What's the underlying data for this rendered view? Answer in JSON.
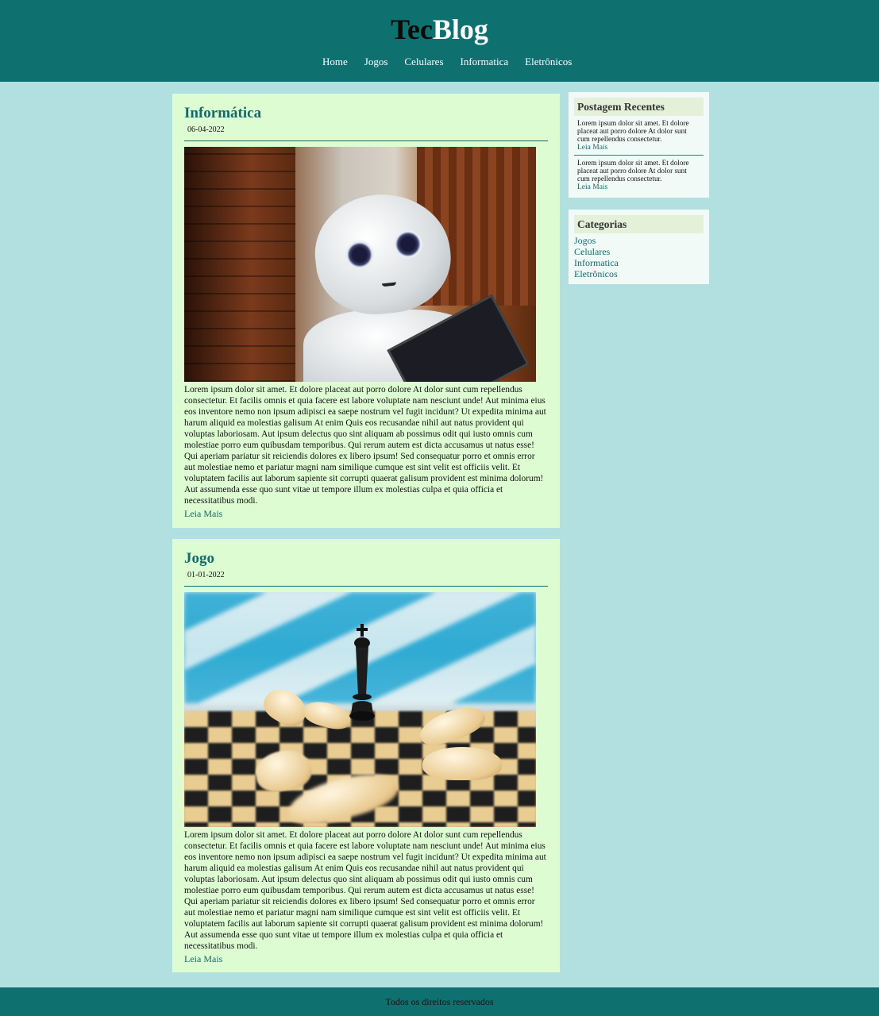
{
  "header": {
    "logo_part1": "Tec",
    "logo_part2": "Blog",
    "nav": [
      "Home",
      "Jogos",
      "Celulares",
      "Informatica",
      "Eletrônicos"
    ]
  },
  "posts": [
    {
      "title": "Informática",
      "date": "06-04-2022",
      "image": "robot-image",
      "body": "Lorem ipsum dolor sit amet. Et dolore placeat aut porro dolore At dolor sunt cum repellendus consectetur. Et facilis omnis et quia facere est labore voluptate nam nesciunt unde! Aut minima eius eos inventore nemo non ipsum adipisci ea saepe nostrum vel fugit incidunt? Ut expedita minima aut harum aliquid ea molestias galisum At enim Quis eos recusandae nihil aut natus provident qui voluptas laboriosam. Aut ipsum delectus quo sint aliquam ab possimus odit qui iusto omnis cum molestiae porro eum quibusdam temporibus. Qui rerum autem est dicta accusamus ut natus esse! Qui aperiam pariatur sit reiciendis dolores ex libero ipsum! Sed consequatur porro et omnis error aut molestiae nemo et pariatur magni nam similique cumque est sint velit est officiis velit. Et voluptatem facilis aut laborum sapiente sit corrupti quaerat galisum provident est minima dolorum! Aut assumenda esse quo sunt vitae ut tempore illum ex molestias culpa et quia officia et necessitatibus modi.",
      "read_more": "Leia Mais"
    },
    {
      "title": "Jogo",
      "date": "01-01-2022",
      "image": "chess-image",
      "body": "Lorem ipsum dolor sit amet. Et dolore placeat aut porro dolore At dolor sunt cum repellendus consectetur. Et facilis omnis et quia facere est labore voluptate nam nesciunt unde! Aut minima eius eos inventore nemo non ipsum adipisci ea saepe nostrum vel fugit incidunt? Ut expedita minima aut harum aliquid ea molestias galisum At enim Quis eos recusandae nihil aut natus provident qui voluptas laboriosam. Aut ipsum delectus quo sint aliquam ab possimus odit qui iusto omnis cum molestiae porro eum quibusdam temporibus. Qui rerum autem est dicta accusamus ut natus esse! Qui aperiam pariatur sit reiciendis dolores ex libero ipsum! Sed consequatur porro et omnis error aut molestiae nemo et pariatur magni nam similique cumque est sint velit est officiis velit. Et voluptatem facilis aut laborum sapiente sit corrupti quaerat galisum provident est minima dolorum! Aut assumenda esse quo sunt vitae ut tempore illum ex molestias culpa et quia officia et necessitatibus modi.",
      "read_more": "Leia Mais"
    }
  ],
  "sidebar": {
    "recent": {
      "title": "Postagem Recentes",
      "items": [
        {
          "text": "Lorem ipsum dolor sit amet. Et dolore placeat aut porro dolore At dolor sunt cum repellendus consectetur.",
          "read_more": "Leia Mais"
        },
        {
          "text": "Lorem ipsum dolor sit amet. Et dolore placeat aut porro dolore At dolor sunt cum repellendus consectetur.",
          "read_more": "Leia Mais"
        }
      ]
    },
    "categories": {
      "title": "Categorias",
      "items": [
        "Jogos",
        "Celulares",
        "Informatica",
        "Eletrônicos"
      ]
    }
  },
  "footer": {
    "text": "Todos os direitos reservados"
  },
  "colors": {
    "header_bg": "#0f7070",
    "page_bg": "#b2dfe0",
    "post_bg": "#ddfcd2",
    "accent": "#136a6a"
  }
}
